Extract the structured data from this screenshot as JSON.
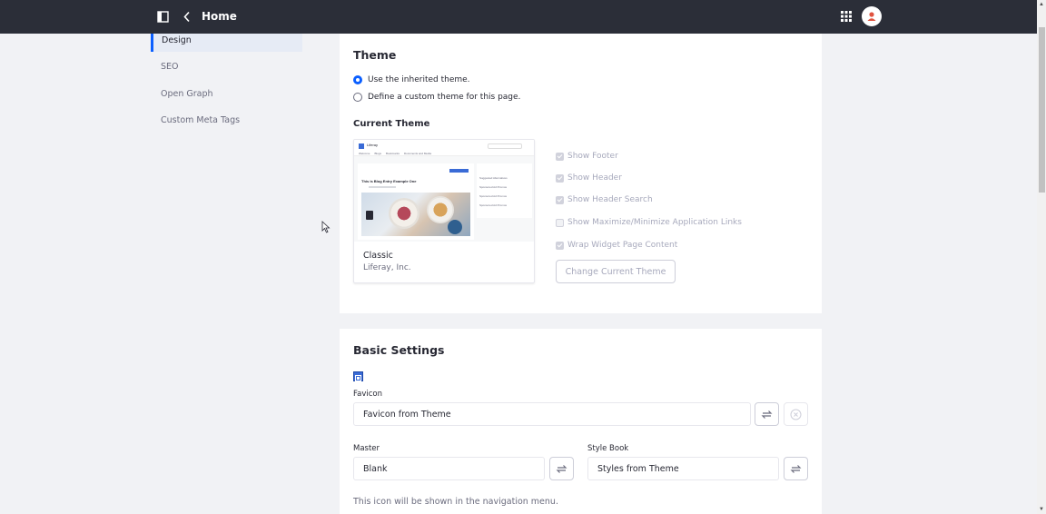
{
  "topbar": {
    "title": "Home",
    "panel_icon": "sidebar-panel-icon",
    "back_icon": "chevron-left-icon",
    "apps_icon": "apps-grid-icon",
    "avatar_icon": "user-avatar-icon"
  },
  "sidenav": {
    "items": [
      {
        "label": "Design",
        "active": true
      },
      {
        "label": "SEO",
        "active": false
      },
      {
        "label": "Open Graph",
        "active": false
      },
      {
        "label": "Custom Meta Tags",
        "active": false
      }
    ]
  },
  "theme": {
    "title": "Theme",
    "options": [
      {
        "label": "Use the inherited theme.",
        "checked": true
      },
      {
        "label": "Define a custom theme for this page.",
        "checked": false
      }
    ],
    "current_theme_title": "Current Theme",
    "current_theme": {
      "name": "Classic",
      "org": "Liferay, Inc.",
      "preview": {
        "logo_text": "Liferay",
        "nav": [
          "Welcome",
          "Blogs",
          "Bookmarks",
          "Documents and Media"
        ],
        "headline": "This is Blog Entry Example One",
        "sidebar_items": [
          "Suggested Alternatives",
          "Sponsored Ad Promos",
          "Sponsored Ad Promos",
          "Sponsored Ad Promos"
        ]
      }
    },
    "settings": [
      {
        "label": "Show Footer",
        "checked": true
      },
      {
        "label": "Show Header",
        "checked": true
      },
      {
        "label": "Show Header Search",
        "checked": true
      },
      {
        "label": "Show Maximize/Minimize Application Links",
        "checked": false
      },
      {
        "label": "Wrap Widget Page Content",
        "checked": true
      }
    ],
    "change_button": "Change Current Theme"
  },
  "basic": {
    "title": "Basic Settings",
    "favicon_label": "Favicon",
    "favicon_value": "Favicon from Theme",
    "master_label": "Master",
    "master_value": "Blank",
    "stylebook_label": "Style Book",
    "stylebook_value": "Styles from Theme",
    "help_text": "This icon will be shown in the navigation menu.",
    "change_icon": "change-arrows-icon",
    "clear_icon": "clear-circle-icon"
  },
  "colors": {
    "topbar": "#2b2e38",
    "accent": "#0b5fff",
    "page_bg": "#f1f2f5"
  }
}
